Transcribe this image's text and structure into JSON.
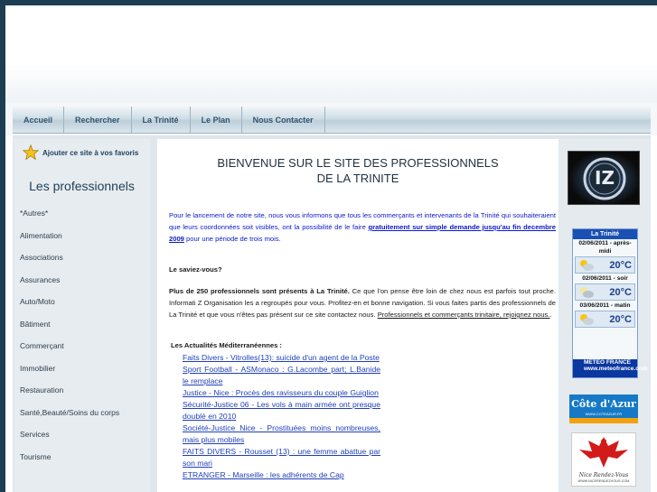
{
  "nav": {
    "items": [
      "Accueil",
      "Rechercher",
      "La Trinité",
      "Le Plan",
      "Nous Contacter"
    ]
  },
  "left": {
    "favorites_label": "Ajouter ce site à vos favoris",
    "title": "Les professionnels",
    "categories": [
      "*Autres*",
      "Alimentation",
      "Associations",
      "Assurances",
      "Auto/Moto",
      "Bâtiment",
      "Commerçant",
      "Immobilier",
      "Restauration",
      "Santé,Beauté/Soins du corps",
      "Services",
      "Tourisme"
    ]
  },
  "main": {
    "welcome_line1": "BIENVENUE SUR LE SITE DES PROFESSIONNELS",
    "welcome_line2": "DE LA TRINITE",
    "intro_text": "Pour le lancement de notre site, nous vous informons que tous les commerçants et intervenants de la Trinité qui souhaiteraient que leurs coordonnées soit visibles, ont la possibilité de le faire",
    "intro_link": "gratuitement sur simple demande jusqu'au fin decembre 2009",
    "intro_end": "pour une période de trois mois.",
    "saviez_title": "Le saviez-vous?",
    "saviez_bold": "Plus de 250 professionnels sont présents à La Trinité.",
    "saviez_text": "Ce que l'on pense être loin de chez nous est parfois tout proche. Informati Z Organisation les a regroupés pour vous. Profitez-en et bonne navigation.",
    "join_text": "Si vous faites partis des professionnels de La Trinité et que vous n'êtes pas présent sur ce site contactez nous.",
    "join_link": "Professionnels et commerçants trinitaire, rejoignez nous.",
    "join_end": ".",
    "news_title": "Les Actualités Méditerranéennes :",
    "news": [
      "Faits Divers - Vitrolles(13): suicide d'un agent de la Poste",
      "Sport Football - ASMonaco : G.Lacombe part; L.Banide le remplace",
      "Justice - Nice : Procès des ravisseurs du couple Guiglion",
      "Sécurité-Justice 06 - Les vols à main armée ont presque doublé en 2010",
      "Société-Justice Nice - Prostituées moins nombreuses, mais plus mobiles",
      "FAITS DIVERS - Rousset (13) : une femme abattue par son mari",
      "ETRANGER - Marseille : les adhérents de Cap"
    ]
  },
  "right": {
    "logo_text": "IZ",
    "weather": {
      "title": "La Trinité",
      "entries": [
        {
          "date": "02/06/2011 - après-midi",
          "temp": "20°C"
        },
        {
          "date": "02/06/2011 - soir",
          "temp": "20°C"
        },
        {
          "date": "03/06/2011 - matin",
          "temp": "20°C"
        }
      ],
      "footer_brand": "METEO FRANCE",
      "footer_url": "www.meteofrance.com"
    },
    "cote_azur": "Côte d'Azur",
    "cote_azur_sub": "WWW.COTEAZUR.FR",
    "nice_title": "Nice Rendez-Vous",
    "nice_url": "WWW.NICERENDEZVOUS.COM"
  },
  "colors": {
    "page_border": "#1d3d52",
    "nav_text": "#34536b",
    "link_blue": "#0a1ac8",
    "news_link": "#1f3fb8",
    "weather_head": "#1a4fb3"
  }
}
